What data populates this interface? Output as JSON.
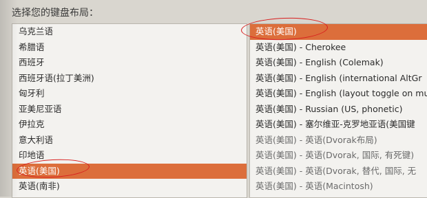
{
  "heading": "选择您的键盘布局：",
  "layouts": [
    {
      "label": "乌克兰语",
      "selected": false
    },
    {
      "label": "希腊语",
      "selected": false
    },
    {
      "label": "西班牙",
      "selected": false
    },
    {
      "label": "西班牙语(拉丁美洲)",
      "selected": false
    },
    {
      "label": "匈牙利",
      "selected": false
    },
    {
      "label": "亚美尼亚语",
      "selected": false
    },
    {
      "label": "伊拉克",
      "selected": false
    },
    {
      "label": "意大利语",
      "selected": false
    },
    {
      "label": "印地语",
      "selected": false
    },
    {
      "label": "英语(美国)",
      "selected": true
    },
    {
      "label": "英语(南非)",
      "selected": false
    }
  ],
  "variants": [
    {
      "label": "英语(美国)",
      "selected": true
    },
    {
      "label": "英语(美国) - Cherokee",
      "selected": false
    },
    {
      "label": "英语(美国) - English (Colemak)",
      "selected": false
    },
    {
      "label": "英语(美国) - English (international AltGr",
      "selected": false
    },
    {
      "label": "英语(美国) - English (layout toggle on mu",
      "selected": false
    },
    {
      "label": "英语(美国) - Russian (US, phonetic)",
      "selected": false
    },
    {
      "label": "英语(美国) - 塞尔维亚-克罗地亚语(美国键",
      "selected": false
    },
    {
      "label": "英语(美国) - 英语(Dvorak布局)",
      "selected": false
    },
    {
      "label": "英语(美国) - 英语(Dvorak, 国际, 有死键)",
      "selected": false
    },
    {
      "label": "英语(美国) - 英语(Dvorak, 替代, 国际, 无",
      "selected": false
    },
    {
      "label": "英语(美国) - 英语(Macintosh)",
      "selected": false
    }
  ],
  "colors": {
    "selection": "#dc6e3b",
    "annotation": "#d81e1e"
  }
}
